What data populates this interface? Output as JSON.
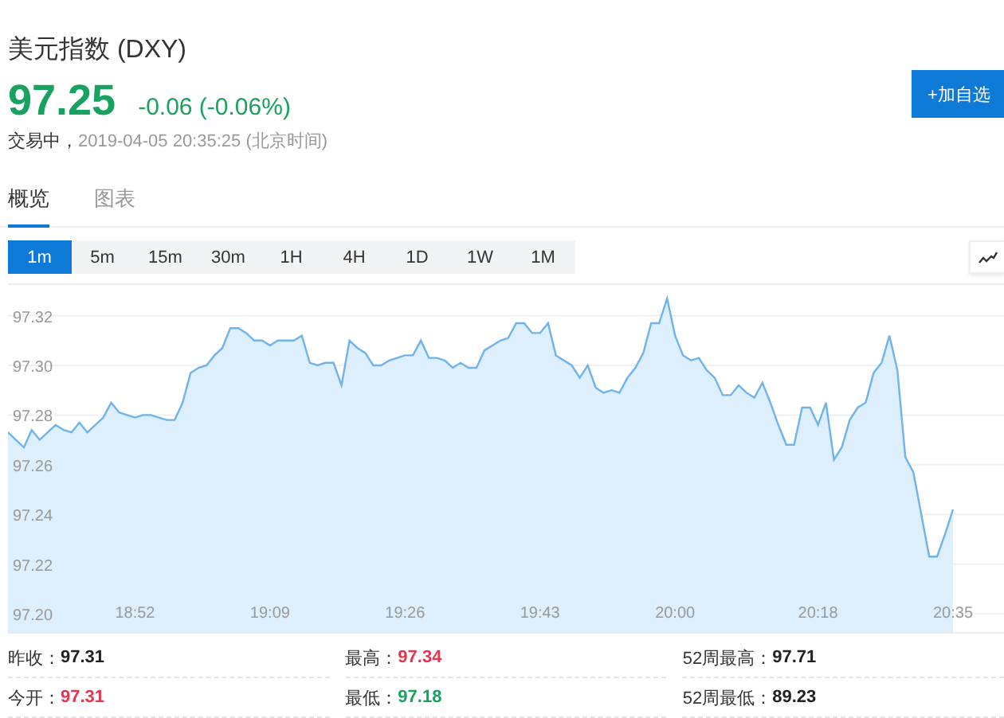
{
  "header": {
    "title": "美元指数 (DXY)",
    "price": "97.25",
    "change": "-0.06 (-0.06%)",
    "status": "交易中，",
    "time": "2019-04-05 20:35:25 (北京时间)",
    "button": "+加自选"
  },
  "tabs": [
    {
      "label": "概览",
      "selected": true
    },
    {
      "label": "图表",
      "selected": false
    }
  ],
  "periods": [
    {
      "label": "1m",
      "selected": true
    },
    {
      "label": "5m",
      "selected": false
    },
    {
      "label": "15m",
      "selected": false
    },
    {
      "label": "30m",
      "selected": false
    },
    {
      "label": "1H",
      "selected": false
    },
    {
      "label": "4H",
      "selected": false
    },
    {
      "label": "1D",
      "selected": false
    },
    {
      "label": "1W",
      "selected": false
    },
    {
      "label": "1M",
      "selected": false
    }
  ],
  "chart_data": {
    "type": "area",
    "grid": true,
    "ylim": [
      97.192,
      97.333
    ],
    "yticks": [
      {
        "value": 97.2,
        "label": "97.20"
      },
      {
        "value": 97.22,
        "label": "97.22"
      },
      {
        "value": 97.24,
        "label": "97.24"
      },
      {
        "value": 97.26,
        "label": "97.26"
      },
      {
        "value": 97.28,
        "label": "97.28"
      },
      {
        "value": 97.3,
        "label": "97.30"
      },
      {
        "value": 97.32,
        "label": "97.32"
      }
    ],
    "categories": [
      null,
      null,
      null,
      null,
      null,
      null,
      null,
      null,
      null,
      null,
      null,
      null,
      null,
      null,
      null,
      null,
      "18:52",
      null,
      null,
      null,
      null,
      null,
      null,
      null,
      null,
      null,
      null,
      null,
      null,
      null,
      null,
      null,
      null,
      "19:09",
      null,
      null,
      null,
      null,
      null,
      null,
      null,
      null,
      null,
      null,
      null,
      null,
      null,
      null,
      null,
      null,
      "19:26",
      null,
      null,
      null,
      null,
      null,
      null,
      null,
      null,
      null,
      null,
      null,
      null,
      null,
      null,
      null,
      null,
      "19:43",
      null,
      null,
      null,
      null,
      null,
      null,
      null,
      null,
      null,
      null,
      null,
      null,
      null,
      null,
      null,
      null,
      "20:00",
      null,
      null,
      null,
      null,
      null,
      null,
      null,
      null,
      null,
      null,
      null,
      null,
      null,
      null,
      null,
      null,
      null,
      "20:18",
      null,
      null,
      null,
      null,
      null,
      null,
      null,
      null,
      null,
      null,
      null,
      null,
      null,
      null,
      null,
      null,
      "20:35"
    ],
    "series": [
      {
        "color": "#6fb3ec",
        "values": [
          97.273,
          97.27,
          97.267,
          97.274,
          97.27,
          97.273,
          97.276,
          97.274,
          97.273,
          97.277,
          97.273,
          97.276,
          97.279,
          97.285,
          97.281,
          97.28,
          97.279,
          97.28,
          97.28,
          97.279,
          97.278,
          97.278,
          97.285,
          97.297,
          97.299,
          97.3,
          97.304,
          97.307,
          97.315,
          97.315,
          97.313,
          97.31,
          97.31,
          97.308,
          97.31,
          97.31,
          97.31,
          97.312,
          97.301,
          97.3,
          97.301,
          97.301,
          97.292,
          97.31,
          97.307,
          97.305,
          97.3,
          97.3,
          97.302,
          97.303,
          97.304,
          97.304,
          97.31,
          97.303,
          97.303,
          97.302,
          97.299,
          97.301,
          97.299,
          97.299,
          97.306,
          97.308,
          97.31,
          97.311,
          97.317,
          97.317,
          97.313,
          97.313,
          97.317,
          97.304,
          97.302,
          97.3,
          97.295,
          97.3,
          97.291,
          97.289,
          97.29,
          97.289,
          97.295,
          97.299,
          97.305,
          97.317,
          97.317,
          97.327,
          97.312,
          97.304,
          97.302,
          97.303,
          97.298,
          97.295,
          97.288,
          97.288,
          97.292,
          97.289,
          97.287,
          97.293,
          97.285,
          97.276,
          97.268,
          97.268,
          97.283,
          97.283,
          97.276,
          97.285,
          97.262,
          97.267,
          97.278,
          97.283,
          97.285,
          97.297,
          97.301,
          97.312,
          97.298,
          97.263,
          97.257,
          97.24,
          97.223,
          97.223,
          97.232,
          97.242
        ]
      }
    ]
  },
  "stats": [
    {
      "label": "昨收：",
      "value": "97.31",
      "color": "#222222"
    },
    {
      "label": "最高：",
      "value": "97.34",
      "color": "#e8344e"
    },
    {
      "label": "52周最高：",
      "value": "97.71",
      "color": "#222222"
    },
    {
      "label": "今开：",
      "value": "97.31",
      "color": "#e8344e"
    },
    {
      "label": "最低：",
      "value": "97.18",
      "color": "#19a15f"
    },
    {
      "label": "52周最低：",
      "value": "89.23",
      "color": "#222222"
    }
  ]
}
